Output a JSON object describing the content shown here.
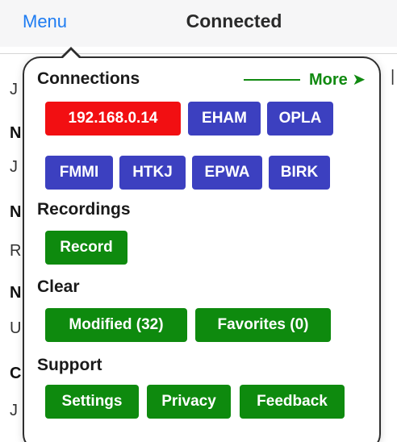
{
  "navbar": {
    "menu_label": "Menu",
    "title": "Connected"
  },
  "background_rows": [
    "J",
    "N",
    "J",
    "N",
    "R",
    "N",
    "U",
    "C",
    "J"
  ],
  "popover": {
    "connections": {
      "title": "Connections",
      "more_label": "More ➤",
      "chips": [
        {
          "label": "192.168.0.14",
          "color": "#f20f12"
        },
        {
          "label": "EHAM",
          "color": "#3c40c0"
        },
        {
          "label": "OPLA",
          "color": "#3c40c0"
        },
        {
          "label": "FMMI",
          "color": "#3c40c0"
        },
        {
          "label": "HTKJ",
          "color": "#3c40c0"
        },
        {
          "label": "EPWA",
          "color": "#3c40c0"
        },
        {
          "label": "BIRK",
          "color": "#3c40c0"
        }
      ]
    },
    "recordings": {
      "title": "Recordings",
      "record_label": "Record"
    },
    "clear": {
      "title": "Clear",
      "modified_label": "Modified (32)",
      "favorites_label": "Favorites (0)"
    },
    "support": {
      "title": "Support",
      "settings_label": "Settings",
      "privacy_label": "Privacy",
      "feedback_label": "Feedback"
    }
  },
  "colors": {
    "accent_link": "#1e7cf2",
    "connected_chip": "#f20f12",
    "airport_chip": "#3c40c0",
    "action_chip": "#0e8a0e"
  }
}
